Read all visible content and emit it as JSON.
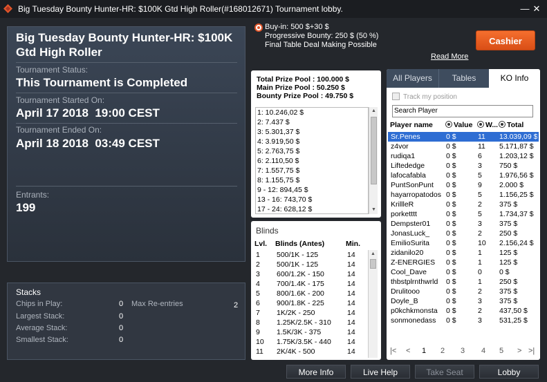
{
  "window": {
    "title": "Big Tuesday Bounty Hunter-HR: $100K Gtd High Roller(#168012671) Tournament lobby.",
    "min_glyph": "—",
    "close_glyph": "✕"
  },
  "summary": {
    "name": "Big Tuesday Bounty Hunter-HR: $100K Gtd High Roller",
    "status_label": "Tournament Status:",
    "status_value": "This Tournament is Completed",
    "started_label": "Tournament Started On:",
    "started_value": "April 17 2018  19:00 CEST",
    "ended_label": "Tournament Ended On:",
    "ended_value": "April 18 2018  03:49 CEST",
    "entrants_label": "Entrants:",
    "entrants_value": "199"
  },
  "stacks": {
    "title": "Stacks",
    "chips_label": "Chips in Play:",
    "chips_value": "0",
    "largest_label": "Largest Stack:",
    "largest_value": "0",
    "average_label": "Average Stack:",
    "average_value": "0",
    "smallest_label": "Smallest Stack:",
    "smallest_value": "0",
    "reentries_label": "Max Re-entries",
    "reentries_value": "2"
  },
  "info": {
    "buyin": "Buy-in: 500 $+30 $",
    "bounty": "Progressive Bounty: 250 $ (50 %)",
    "deal": "Final Table Deal Making Possible",
    "read_more": "Read More",
    "cashier": "Cashier"
  },
  "prize": {
    "total": "Total Prize Pool : 100.000 $",
    "main": "Main Prize Pool : 50.250 $",
    "bounty": "Bounty Prize Pool : 49.750 $",
    "places": [
      "1: 10.246,02 $",
      "2: 7.437 $",
      "3: 5.301,37 $",
      "4: 3.919,50 $",
      "5: 2.763,75 $",
      "6: 2.110,50 $",
      "7: 1.557,75 $",
      "8: 1.155,75 $",
      "9 - 12: 894,45 $",
      "13 - 16: 743,70 $",
      "17 - 24: 628,12 $"
    ]
  },
  "blinds": {
    "title": "Blinds",
    "col_lvl": "Lvl.",
    "col_blinds": "Blinds (Antes)",
    "col_min": "Min.",
    "rows": [
      {
        "lvl": "1",
        "blinds": "500/1K - 125",
        "min": "14"
      },
      {
        "lvl": "2",
        "blinds": "500/1K - 125",
        "min": "14"
      },
      {
        "lvl": "3",
        "blinds": "600/1.2K - 150",
        "min": "14"
      },
      {
        "lvl": "4",
        "blinds": "700/1.4K - 175",
        "min": "14"
      },
      {
        "lvl": "5",
        "blinds": "800/1.6K - 200",
        "min": "14"
      },
      {
        "lvl": "6",
        "blinds": "900/1.8K - 225",
        "min": "14"
      },
      {
        "lvl": "7",
        "blinds": "1K/2K - 250",
        "min": "14"
      },
      {
        "lvl": "8",
        "blinds": "1.25K/2.5K - 310",
        "min": "14"
      },
      {
        "lvl": "9",
        "blinds": "1.5K/3K - 375",
        "min": "14"
      },
      {
        "lvl": "10",
        "blinds": "1.75K/3.5K - 440",
        "min": "14"
      },
      {
        "lvl": "11",
        "blinds": "2K/4K - 500",
        "min": "14"
      }
    ]
  },
  "right": {
    "tabs": [
      "All Players",
      "Tables",
      "KO Info"
    ],
    "track_label": "Track my position",
    "search_placeholder": "Search Player",
    "col_player": "Player name",
    "col_value": "Value",
    "col_won": "W...",
    "col_total": "Total",
    "rows": [
      {
        "name": "Sr.Penes",
        "value": "0 $",
        "won": "11",
        "total": "13.039,09 $"
      },
      {
        "name": "z4vor",
        "value": "0 $",
        "won": "11",
        "total": "5.171,87 $"
      },
      {
        "name": "rudiqa1",
        "value": "0 $",
        "won": "6",
        "total": "1.203,12 $"
      },
      {
        "name": "Liftededge",
        "value": "0 $",
        "won": "3",
        "total": "750 $"
      },
      {
        "name": "lafocafabla",
        "value": "0 $",
        "won": "5",
        "total": "1.976,56 $"
      },
      {
        "name": "PuntSonPunt",
        "value": "0 $",
        "won": "9",
        "total": "2.000 $"
      },
      {
        "name": "hayarropatodos",
        "value": "0 $",
        "won": "5",
        "total": "1.156,25 $"
      },
      {
        "name": "KrillleR",
        "value": "0 $",
        "won": "2",
        "total": "375 $"
      },
      {
        "name": "porketttt",
        "value": "0 $",
        "won": "5",
        "total": "1.734,37 $"
      },
      {
        "name": "Dempster01",
        "value": "0 $",
        "won": "3",
        "total": "375 $"
      },
      {
        "name": "JonasLuck_",
        "value": "0 $",
        "won": "2",
        "total": "250 $"
      },
      {
        "name": "EmilioSurita",
        "value": "0 $",
        "won": "10",
        "total": "2.156,24 $"
      },
      {
        "name": "zidanilo20",
        "value": "0 $",
        "won": "1",
        "total": "125 $"
      },
      {
        "name": "Z-ENERGIES",
        "value": "0 $",
        "won": "1",
        "total": "125 $"
      },
      {
        "name": "Cool_Dave",
        "value": "0 $",
        "won": "0",
        "total": "0 $"
      },
      {
        "name": "thbstplrnthwrld",
        "value": "0 $",
        "won": "1",
        "total": "250 $"
      },
      {
        "name": "Drulitooo",
        "value": "0 $",
        "won": "2",
        "total": "375 $"
      },
      {
        "name": "Doyle_B",
        "value": "0 $",
        "won": "3",
        "total": "375 $"
      },
      {
        "name": "p0kchkmonsta",
        "value": "0 $",
        "won": "2",
        "total": "437,50 $"
      },
      {
        "name": "sonmonedass",
        "value": "0 $",
        "won": "3",
        "total": "531,25 $"
      }
    ],
    "pages": [
      "1",
      "2",
      "3",
      "4",
      "5"
    ],
    "first_glyph": "|<",
    "prev_glyph": "<",
    "next_glyph": ">",
    "last_glyph": ">|"
  },
  "buttons": {
    "more_info": "More Info",
    "live_help": "Live Help",
    "take_seat": "Take Seat",
    "lobby": "Lobby"
  }
}
